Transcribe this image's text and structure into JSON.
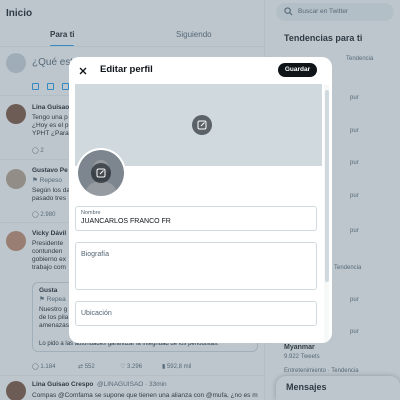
{
  "main": {
    "title": "Inicio",
    "tabs": [
      "Para ti",
      "Siguiendo"
    ],
    "compose_placeholder": "¿Qué est"
  },
  "tweets": [
    {
      "name": "Lina Guisao",
      "lines": [
        "Tengo una p",
        "¿Hoy es el p",
        "YPHT ¿Para"
      ],
      "stats": {
        "replies": "2"
      },
      "avatar_color": "#7a4e3a"
    },
    {
      "name": "Gustavo Pe",
      "repost": "⚑ Repeso",
      "lines": [
        "Según los da",
        "pasado tres"
      ],
      "stats": {
        "replies": "2.980"
      },
      "avatar_color": "#b8a089"
    },
    {
      "name": "Vicky Dávil",
      "lines": [
        "Presidente",
        "contunden",
        "gobierno ex",
        "trabajo com"
      ],
      "quote": {
        "author": "Gusta",
        "repost": "⚑ Repea",
        "lines": [
          "Nuestro g",
          "de los pila",
          "amenazas"
        ],
        "footer": "Lo pido a las autoridades garantizar la integridad de los periodistas."
      },
      "stats": {
        "replies": "1.184",
        "reposts": "552",
        "likes": "3.296",
        "views": "592,8 mil"
      },
      "avatar_color": "#c4896a"
    },
    {
      "name": "Lina Guisao Crespo",
      "handle": "@LINAGUISAO",
      "time": "· 33min",
      "lines": [
        "Compas @Comfama se supone que tienen una alianza con @mufa, ¿no es m"
      ],
      "avatar_color": "#7a4e3a"
    }
  ],
  "right": {
    "search_placeholder": "Buscar en Twitter",
    "trends_title": "Tendencias para ti",
    "trends": [
      {
        "context": "Tendencia"
      },
      {
        "context": "pur"
      },
      {
        "context": "pur"
      },
      {
        "context": "pur"
      },
      {
        "context": "pur"
      },
      {
        "context": "pur"
      },
      {
        "context": "Tendencia"
      },
      {
        "context": "pur"
      },
      {
        "context": "pur"
      }
    ],
    "last_trend_name": "Myanmar",
    "last_trend_posts": "9.922 Tweets",
    "bottom_context": "Entretenimiento · Tendencia",
    "messages_label": "Mensajes"
  },
  "modal": {
    "title": "Editar perfil",
    "close_icon": "close-icon",
    "save_label": "Guardar",
    "fields": {
      "name": {
        "label": "Nombre",
        "value": "JUANCARLOS FRANCO FR"
      },
      "bio": {
        "label": "Biografía",
        "value": ""
      },
      "location": {
        "label": "Ubicación",
        "value": ""
      }
    }
  },
  "colors": {
    "accent": "#1d9bf0",
    "overlay": "rgba(91,112,131,0.4)",
    "save_button": "#0f1419"
  }
}
